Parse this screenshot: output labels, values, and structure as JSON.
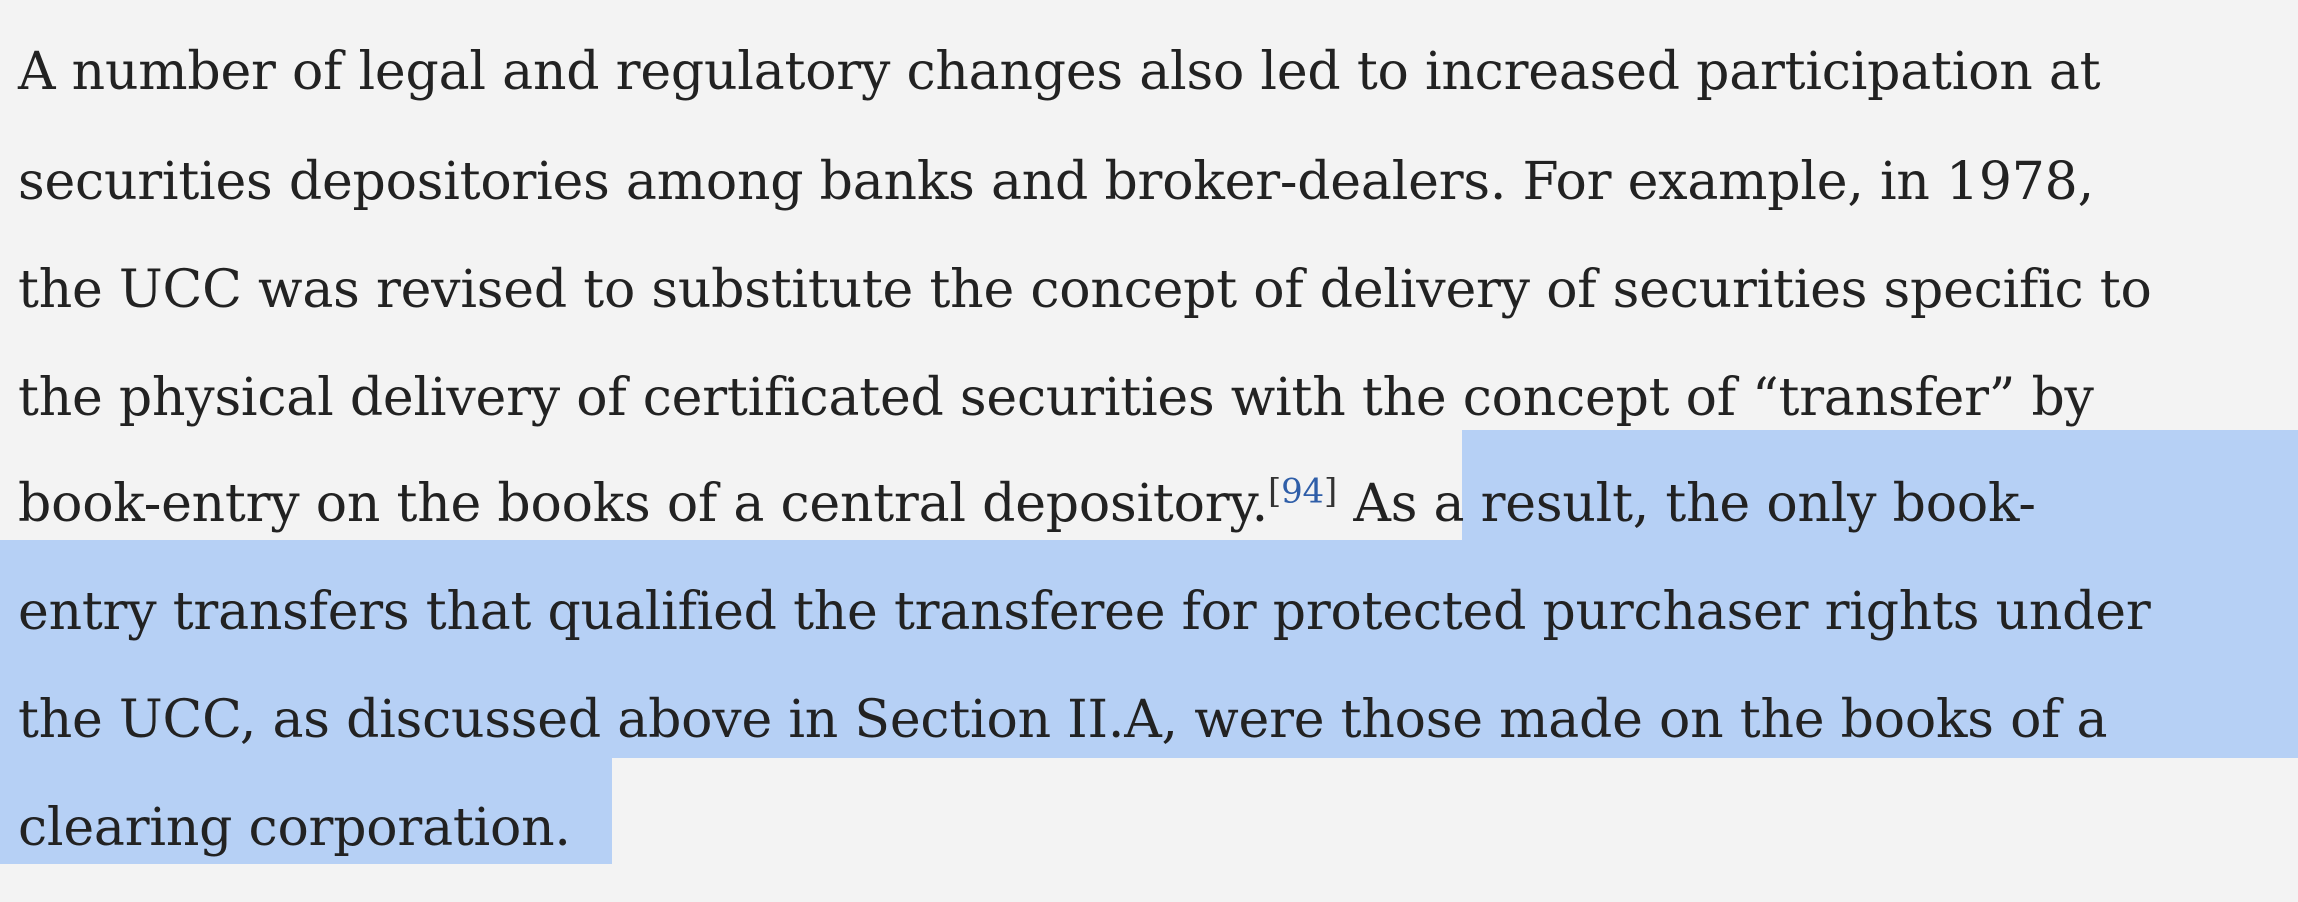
{
  "paragraph": {
    "lines": [
      "A number of legal and regulatory changes also led to increased participation at",
      "securities depositories among banks and broker-dealers. For example, in 1978,",
      "the UCC was revised to substitute the concept of delivery of securities specific to",
      "the physical delivery of certificated securities with the concept of “transfer” by",
      "book-entry on the books of a central depository.",
      "entry transfers that qualified the transferee for protected purchaser rights under",
      "the UCC, as discussed above in Section II.A, were those made on the books of a",
      "clearing corporation."
    ],
    "footnote": {
      "open": "[",
      "number": "94",
      "close": "]"
    },
    "line5_after_footnote": " As a result, the only book-"
  },
  "colors": {
    "background": "#f3f3f3",
    "text": "#222222",
    "selection": "#b6d0f5",
    "footnote_link": "#2f5ea8"
  }
}
